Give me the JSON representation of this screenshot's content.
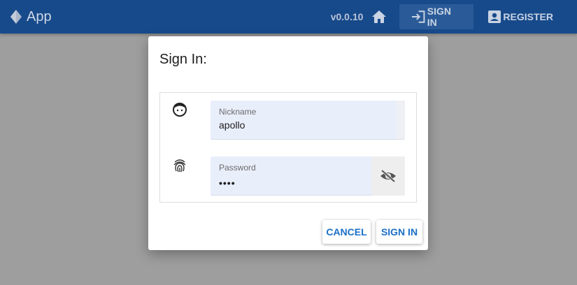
{
  "appbar": {
    "title": "App",
    "version": "v0.0.10",
    "sign_in_label": "SIGN IN",
    "register_label": "REGISTER",
    "color": "#174a8b"
  },
  "dialog": {
    "title": "Sign In:",
    "nickname": {
      "label": "Nickname",
      "value": "apollo",
      "icon": "face-icon"
    },
    "password": {
      "label": "Password",
      "value_masked": "••••",
      "icon": "fingerprint-icon",
      "toggle_icon": "eye-off-icon"
    },
    "cancel_label": "CANCEL",
    "submit_label": "SIGN IN",
    "accent": "#1c6fc7"
  }
}
